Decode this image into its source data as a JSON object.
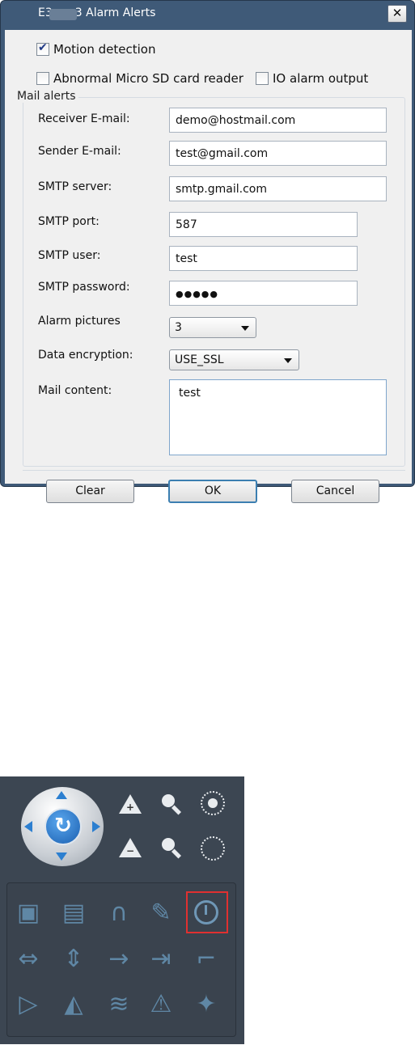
{
  "dialog": {
    "title": "E3……3 Alarm Alerts",
    "close_label": "✕",
    "motion_detection": {
      "label": "Motion detection",
      "checked": true
    },
    "sd_card": {
      "label": "Abnormal Micro SD card reader",
      "checked": false
    },
    "io_output": {
      "label": "IO alarm output",
      "checked": false
    },
    "mail_alerts_legend": "Mail alerts",
    "fields": {
      "receiver_label": "Receiver E-mail:",
      "receiver_value": "demo@hostmail.com",
      "sender_label": "Sender E-mail:",
      "sender_value": "test@gmail.com",
      "smtp_server_label": "SMTP server:",
      "smtp_server_value": "smtp.gmail.com",
      "smtp_port_label": "SMTP port:",
      "smtp_port_value": "587",
      "smtp_user_label": "SMTP user:",
      "smtp_user_value": "test",
      "smtp_password_label": "SMTP password:",
      "smtp_password_value": "●●●●●",
      "alarm_pictures_label": "Alarm pictures",
      "alarm_pictures_value": "3",
      "data_encryption_label": "Data encryption:",
      "data_encryption_value": "USE_SSL",
      "mail_content_label": "Mail content:",
      "mail_content_value": "test"
    },
    "buttons": {
      "clear": "Clear",
      "ok": "OK",
      "cancel": "Cancel"
    }
  },
  "panel": {
    "ptz_icon": "refresh-icon",
    "plus_sign": "+",
    "minus_sign": "−",
    "grid_icons": [
      "camera-icon",
      "clapperboard-icon",
      "headphones-icon",
      "microphone-icon",
      "record-icon",
      "horizontal-arrows-icon",
      "vertical-arrows-icon",
      "arrow-right-icon",
      "input-icon",
      "flag-icon",
      "triangle-icon",
      "mirror-icon",
      "wifi-icon",
      "warning-icon",
      "wrench-icon"
    ],
    "highlight_color": "#e03030"
  }
}
